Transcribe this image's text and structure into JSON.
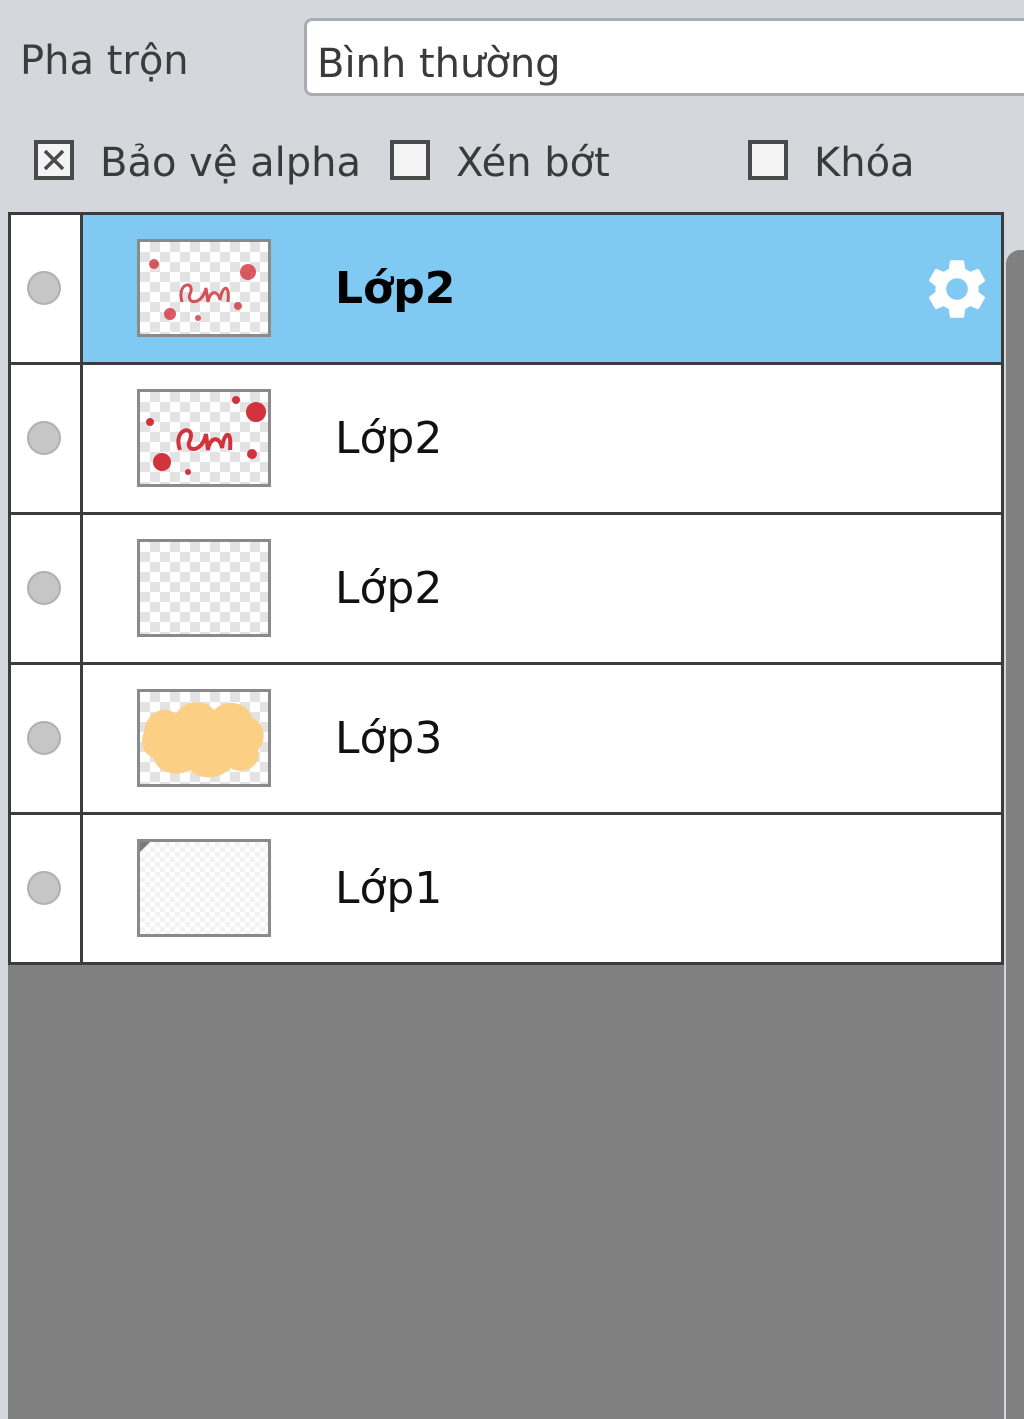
{
  "blend": {
    "label": "Pha trộn",
    "value": "Bình thường"
  },
  "options": {
    "protect_alpha": {
      "label": "Bảo vệ alpha",
      "checked": true
    },
    "clip": {
      "label": "Xén bớt",
      "checked": false
    },
    "lock": {
      "label": "Khóa",
      "checked": false
    }
  },
  "layers": [
    {
      "name": "Lớp2",
      "selected": true,
      "thumbnail": "red-lettering-splatter"
    },
    {
      "name": "Lớp2",
      "selected": false,
      "thumbnail": "red-lettering-splatter"
    },
    {
      "name": "Lớp2",
      "selected": false,
      "thumbnail": "empty-transparent"
    },
    {
      "name": "Lớp3",
      "selected": false,
      "thumbnail": "peach-blob"
    },
    {
      "name": "Lớp1",
      "selected": false,
      "thumbnail": "blank-white"
    }
  ],
  "icons": {
    "layer_settings": "gear-icon",
    "protect_alpha_box": "x-check-icon"
  },
  "colors": {
    "selection": "#7fc9f2",
    "empty_area": "#808080",
    "thumbnail_red": "#d2323c",
    "thumbnail_peach": "#fbcf84"
  }
}
